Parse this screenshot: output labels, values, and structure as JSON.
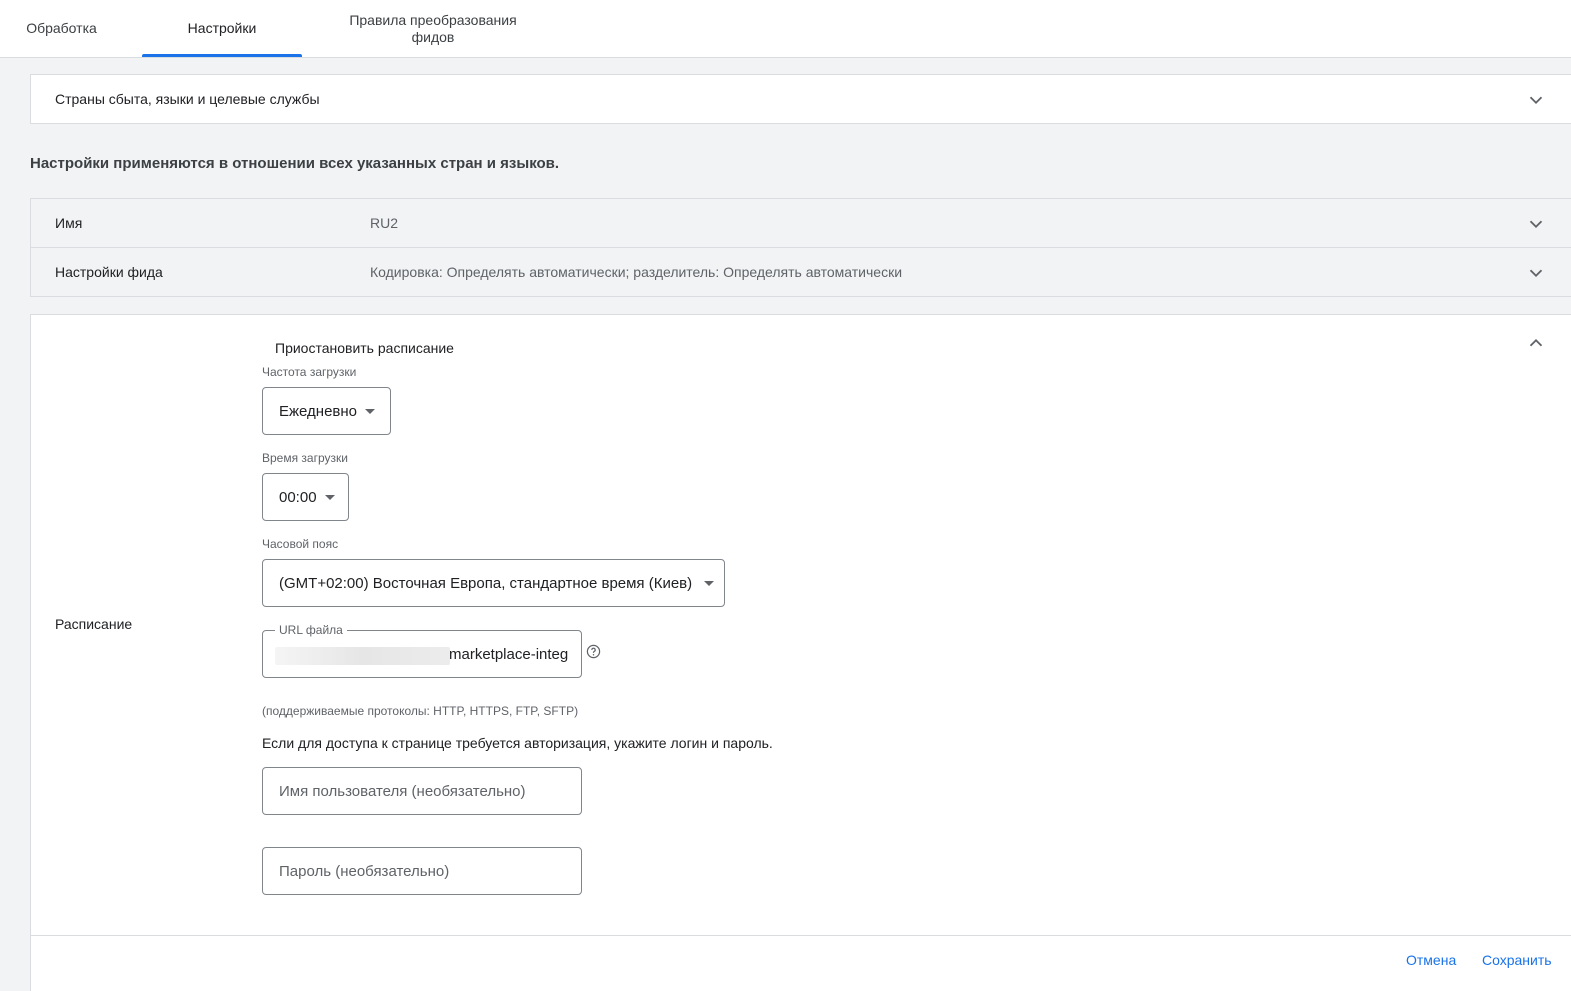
{
  "tabs": [
    {
      "label": "Обработка"
    },
    {
      "label": "Настройки"
    },
    {
      "label": "Правила преобразования фидов"
    }
  ],
  "sections": {
    "markets": {
      "title": "Страны сбыта, языки и целевые службы"
    },
    "note": "Настройки применяются в отношении всех указанных стран и языков.",
    "name": {
      "title": "Имя",
      "value": "RU2"
    },
    "feed_settings": {
      "title": "Настройки фида",
      "value": "Кодировка: Определять автоматически; разделитель: Определять автоматически"
    }
  },
  "schedule": {
    "title": "Расписание",
    "pause_label": "Приостановить расписание",
    "frequency": {
      "label": "Частота загрузки",
      "value": "Ежедневно"
    },
    "time": {
      "label": "Время загрузки",
      "value": "00:00"
    },
    "timezone": {
      "label": "Часовой пояс",
      "value": "(GMT+02:00) Восточная Европа, стандартное время (Киев)"
    },
    "url": {
      "label": "URL файла",
      "value": "marketplace-integ"
    },
    "protocols_hint": "(поддерживаемые протоколы: HTTP, HTTPS, FTP, SFTP)",
    "auth_note": "Если для доступа к странице требуется авторизация, укажите логин и пароль.",
    "username_placeholder": "Имя пользователя (необязательно)",
    "password_placeholder": "Пароль (необязательно)"
  },
  "actions": {
    "cancel": "Отмена",
    "save": "Сохранить"
  },
  "colors": {
    "accent": "#1a73e8",
    "background": "#f1f3f4"
  },
  "icons": {
    "expand": "chevron-down-icon",
    "collapse": "chevron-up-icon",
    "help": "help-circle-icon"
  }
}
